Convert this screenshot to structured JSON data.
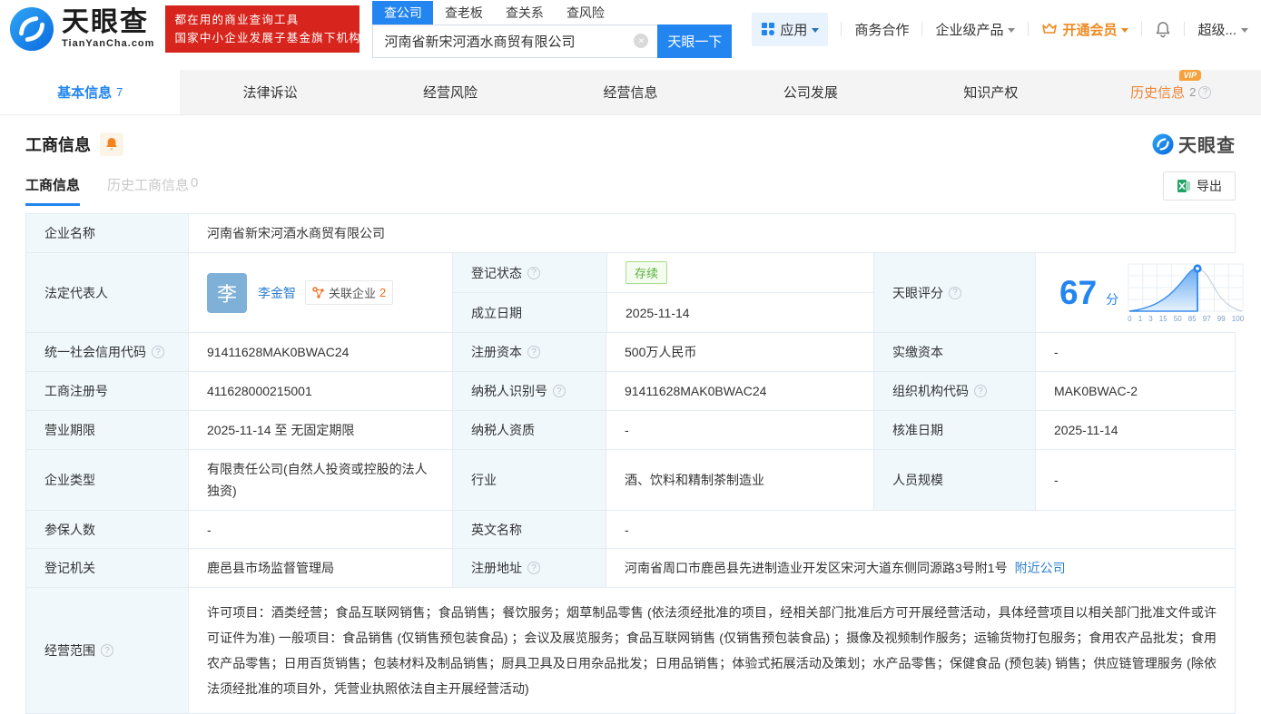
{
  "header": {
    "logo": {
      "brand": "天眼查",
      "domain": "TianYanCha.com"
    },
    "banner": {
      "line1": "都在用的商业查询工具",
      "line2": "国家中小企业发展子基金旗下机构"
    },
    "search": {
      "tabs": [
        {
          "label": "查公司"
        },
        {
          "label": "查老板"
        },
        {
          "label": "查关系"
        },
        {
          "label": "查风险"
        }
      ],
      "value": "河南省新宋河酒水商贸有限公司",
      "button": "天眼一下"
    },
    "nav": {
      "apps": "应用",
      "business": "商务合作",
      "enterprise": "企业级产品",
      "vip": "开通会员",
      "more": "超级..."
    }
  },
  "tabbar": {
    "tabs": [
      {
        "label": "基本信息",
        "count": "7"
      },
      {
        "label": "法律诉讼"
      },
      {
        "label": "经营风险"
      },
      {
        "label": "经营信息"
      },
      {
        "label": "公司发展"
      },
      {
        "label": "知识产权"
      },
      {
        "label": "历史信息",
        "count": "2",
        "vip_badge": "VIP"
      }
    ]
  },
  "section": {
    "title": "工商信息",
    "watermark": "天眼查",
    "subtabs": [
      {
        "label": "工商信息"
      },
      {
        "label": "历史工商信息",
        "count": "0"
      }
    ],
    "export_label": "导出"
  },
  "table": {
    "company_name": {
      "label": "企业名称",
      "value": "河南省新宋河酒水商贸有限公司"
    },
    "legal_rep": {
      "label": "法定代表人",
      "avatar": "李",
      "name": "李金智",
      "related_label": "关联企业",
      "related_count": "2"
    },
    "reg_status": {
      "label": "登记状态",
      "value": "存续"
    },
    "establish": {
      "label": "成立日期",
      "value": "2025-11-14"
    },
    "score": {
      "label": "天眼评分",
      "value": "67",
      "unit": "分",
      "ticks": [
        "0",
        "1",
        "3",
        "15",
        "50",
        "85",
        "97",
        "99",
        "100"
      ]
    },
    "credit_code": {
      "label": "统一社会信用代码",
      "value": "91411628MAK0BWAC24"
    },
    "reg_capital": {
      "label": "注册资本",
      "value": "500万人民币"
    },
    "paid_capital": {
      "label": "实缴资本",
      "value": "-"
    },
    "reg_number": {
      "label": "工商注册号",
      "value": "411628000215001"
    },
    "taxpayer_id": {
      "label": "纳税人识别号",
      "value": "91411628MAK0BWAC24"
    },
    "org_code": {
      "label": "组织机构代码",
      "value": "MAK0BWAC-2"
    },
    "term": {
      "label": "营业期限",
      "value": "2025-11-14 至 无固定期限"
    },
    "taxpayer_quality": {
      "label": "纳税人资质",
      "value": "-"
    },
    "approval": {
      "label": "核准日期",
      "value": "2025-11-14"
    },
    "type": {
      "label": "企业类型",
      "value": "有限责任公司(自然人投资或控股的法人独资)"
    },
    "industry": {
      "label": "行业",
      "value": "酒、饮料和精制茶制造业"
    },
    "staff": {
      "label": "人员规模",
      "value": "-"
    },
    "insured": {
      "label": "参保人数",
      "value": "-"
    },
    "en_name": {
      "label": "英文名称",
      "value": "-"
    },
    "authority": {
      "label": "登记机关",
      "value": "鹿邑县市场监督管理局"
    },
    "address": {
      "label": "注册地址",
      "value": "河南省周口市鹿邑县先进制造业开发区宋河大道东侧同源路3号附1号",
      "nearby": "附近公司"
    },
    "scope": {
      "label": "经营范围",
      "value": "许可项目：酒类经营；食品互联网销售；食品销售；餐饮服务；烟草制品零售 (依法须经批准的项目，经相关部门批准后方可开展经营活动，具体经营项目以相关部门批准文件或许可证件为准) 一般项目：食品销售 (仅销售预包装食品) ；会议及展览服务；食品互联网销售 (仅销售预包装食品) ；摄像及视频制作服务；运输货物打包服务；食用农产品批发；食用农产品零售；日用百货销售；包装材料及制品销售；厨具卫具及日用杂品批发；日用品销售；体验式拓展活动及策划；水产品零售；保健食品 (预包装) 销售；供应链管理服务 (除依法须经批准的项目外，凭营业执照依法自主开展经营活动)"
    }
  }
}
